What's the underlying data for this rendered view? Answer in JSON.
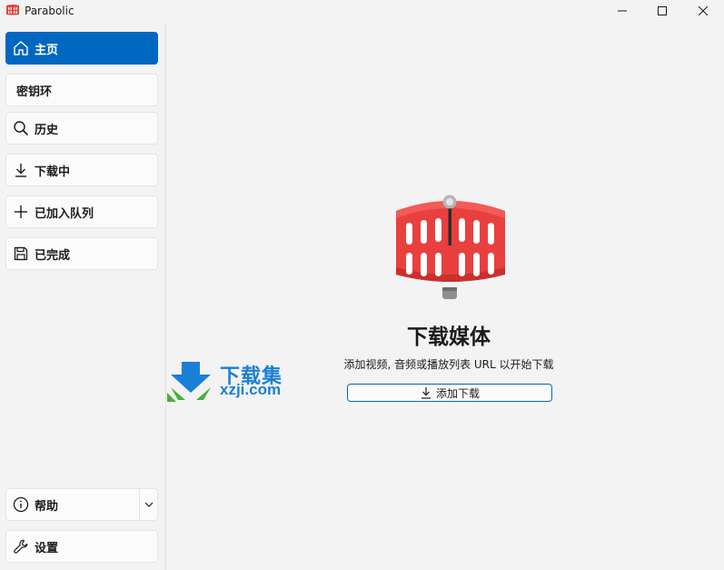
{
  "window": {
    "title": "Parabolic",
    "minimize_icon": "minimize-icon",
    "maximize_icon": "maximize-icon",
    "close_icon": "close-icon"
  },
  "sidebar": {
    "items": [
      {
        "label": "主页",
        "icon": "home-icon",
        "active": true
      },
      {
        "label": "密钥环",
        "icon": null,
        "active": false
      },
      {
        "label": "历史",
        "icon": "search-icon",
        "active": false
      },
      {
        "label": "下载中",
        "icon": "download-icon",
        "active": false
      },
      {
        "label": "已加入队列",
        "icon": "plus-icon",
        "active": false
      },
      {
        "label": "已完成",
        "icon": "save-icon",
        "active": false
      }
    ],
    "bottom_items": [
      {
        "label": "帮助",
        "icon": "info-icon",
        "has_dropdown": true
      },
      {
        "label": "设置",
        "icon": "wrench-icon"
      }
    ]
  },
  "main": {
    "title": "下载媒体",
    "description": "添加视频, 音频或播放列表 URL 以开始下载",
    "add_button_label": "添加下载"
  },
  "watermark": {
    "chinese": "下载集",
    "domain": "xzji.com"
  },
  "colors": {
    "accent": "#0067c0",
    "background": "#f3f3f3",
    "logo_red": "#e8403f",
    "watermark_blue": "#1a7fd6",
    "watermark_green": "#4cae3b"
  }
}
